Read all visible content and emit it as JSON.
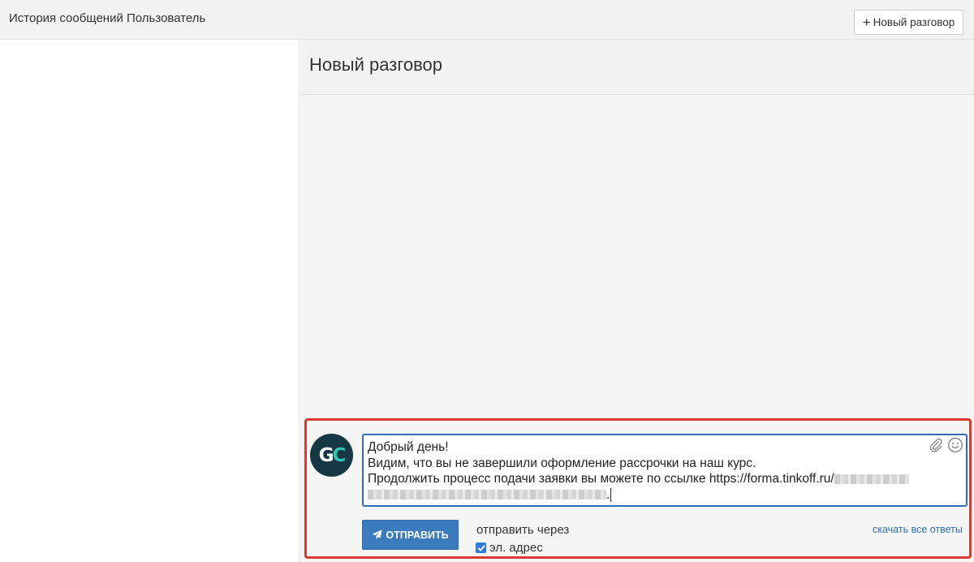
{
  "topbar": {
    "title": "История сообщений Пользователь",
    "new_conversation_label": "Новый разговор"
  },
  "conversation": {
    "title": "Новый разговор"
  },
  "composer": {
    "avatar_initials": [
      "G",
      "C"
    ],
    "message_lines": [
      "Добрый день!",
      "Видим, что вы не завершили оформление рассрочки на наш курс.",
      "Продолжить процесс подачи заявки вы можете по ссылке https://forma.tinkoff.ru/"
    ],
    "trailing_char": ".",
    "send_label": "ОТПРАВИТЬ",
    "send_via_label": "отправить через",
    "channel_label": "эл. адрес",
    "channel_checked": true,
    "download_label": "скачать все ответы"
  },
  "icons": {
    "new_conversation": "plus-icon",
    "attach": "paperclip-icon",
    "emoji": "smiley-icon",
    "send": "paper-plane-icon",
    "checkbox": "checkmark-icon"
  },
  "colors": {
    "highlight_border": "#d93a33",
    "send_button": "#3a7bbd",
    "editor_border": "#2f6db8",
    "avatar_bg": "#163845",
    "avatar_accent": "#2ec4b0",
    "link": "#2d6fb8"
  }
}
